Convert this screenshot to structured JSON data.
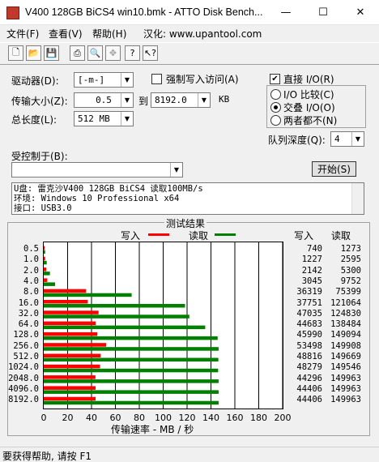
{
  "window": {
    "title": "V400 128GB BiCS4 win10.bmk - ATTO Disk Bench...",
    "min": "—",
    "max": "☐",
    "close": "✕"
  },
  "menu": [
    "文件(F)",
    "查看(V)",
    "帮助(H)",
    "汉化: www.upantool.com"
  ],
  "toolbar": [
    {
      "icon": "new-document-icon",
      "glyph": "🗋"
    },
    {
      "icon": "open-folder-icon",
      "glyph": "📂"
    },
    {
      "icon": "save-icon",
      "glyph": "💾"
    },
    {
      "icon": "print-icon",
      "glyph": "⎙"
    },
    {
      "icon": "print-preview-icon",
      "glyph": "🔍"
    },
    {
      "icon": "move-icon",
      "glyph": "✥"
    },
    {
      "icon": "help-icon",
      "glyph": "?"
    },
    {
      "icon": "context-help-icon",
      "glyph": "↖?"
    }
  ],
  "form": {
    "drive_label": "驱动器(D):",
    "drive_value": "[-m-]",
    "force_write_label": "强制写入访问(A)",
    "transfer_label": "传输大小(Z):",
    "transfer_from": "0.5",
    "to_label": "到",
    "transfer_to": "8192.0",
    "kb_label": "KB",
    "length_label": "总长度(L):",
    "length_value": "512 MB",
    "direct_io_label": "直接 I/O(R)",
    "io_compare_label": "I/O 比较(C)",
    "overlapped_io_label": "交叠 I/O(O)",
    "neither_label": "两者都不(N)",
    "queue_label": "队列深度(Q):",
    "queue_value": "4",
    "controlled_label": "受控制于(B):",
    "controlled_value": "",
    "start_label": "开始(S)"
  },
  "info_lines": [
    "U盘: 雷克沙V400 128GB BiCS4 读取100MB/s",
    "环境: Windows 10 Professional x64",
    "接口: USB3.0"
  ],
  "results": {
    "title": "测试结果",
    "legend_write": "写入",
    "legend_read": "读取",
    "col_write": "写入",
    "col_read": "读取",
    "x_axis_label": "传输速率 - MB / 秒"
  },
  "colors": {
    "write": "#ff0000",
    "read": "#008000"
  },
  "chart_data": {
    "type": "bar",
    "orientation": "horizontal",
    "categories": [
      "0.5",
      "1.0",
      "2.0",
      "4.0",
      "8.0",
      "16.0",
      "32.0",
      "64.0",
      "128.0",
      "256.0",
      "512.0",
      "1024.0",
      "2048.0",
      "4096.0",
      "8192.0"
    ],
    "series": [
      {
        "name": "写入",
        "values": [
          0.7,
          1.2,
          2.1,
          3.0,
          35.5,
          36.9,
          45.9,
          43.6,
          44.9,
          52.2,
          47.7,
          47.1,
          43.3,
          43.4,
          43.4
        ]
      },
      {
        "name": "读取",
        "values": [
          1.2,
          2.5,
          5.2,
          9.5,
          73.6,
          118.3,
          121.9,
          135.2,
          145.6,
          146.4,
          146.2,
          146.0,
          146.4,
          146.4,
          146.4
        ]
      }
    ],
    "write_kbs": [
      "740",
      "1227",
      "2142",
      "3045",
      "36319",
      "37751",
      "47035",
      "44683",
      "45990",
      "53498",
      "48816",
      "48279",
      "44296",
      "44406",
      "44406"
    ],
    "read_kbs": [
      "1273",
      "2595",
      "5300",
      "9752",
      "75399",
      "121064",
      "124830",
      "138484",
      "149094",
      "149908",
      "149669",
      "149546",
      "149963",
      "149963",
      "149963"
    ],
    "x_ticks": [
      "0",
      "20",
      "40",
      "60",
      "80",
      "100",
      "120",
      "140",
      "160",
      "180",
      "200"
    ],
    "xlim": [
      0,
      200
    ],
    "xlabel": "传输速率 - MB / 秒",
    "grid": true
  },
  "status": "要获得帮助, 请按 F1"
}
